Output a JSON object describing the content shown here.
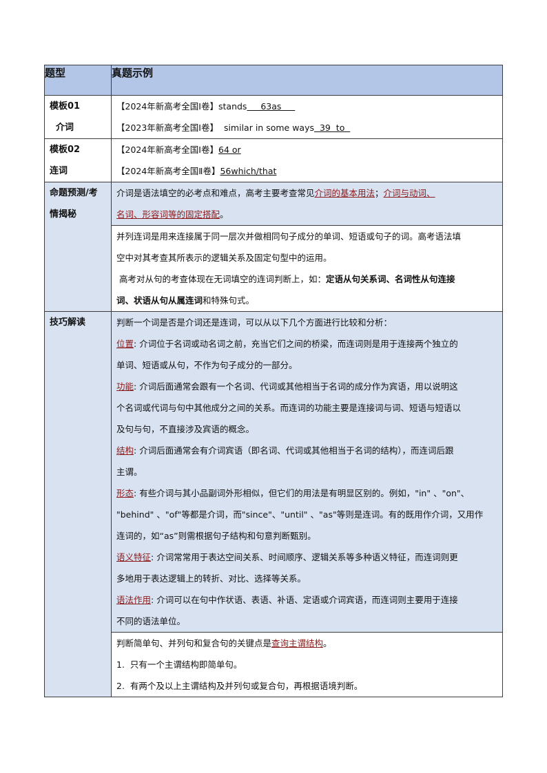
{
  "header": {
    "col1": "题型",
    "col2": "真题示例"
  },
  "row1": {
    "label_a": "模板01",
    "label_b": "介词",
    "ex1_pre": "【2024年新高考全国Ⅰ卷】stands",
    "ex1_ans": "     63as     ",
    "ex2_pre": "【2023年新高考全国Ⅰ卷】  similar in some ways",
    "ex2_ans": "  39  to  "
  },
  "row2": {
    "label_a": "模板02",
    "label_b": "连词",
    "ex1_pre": "【2024年新高考全国Ⅰ卷】",
    "ex1_ans": "64 or",
    "ex2_pre": "【2024年新高考全国Ⅱ卷】",
    "ex2_ans": "56which/that"
  },
  "row3": {
    "label_a": "命题预测/考",
    "label_b": "情揭秘",
    "p1_a": "介词是语法填空的必考点和难点，高考主要考查常见",
    "p1_u1": "介词的基本用法",
    "p1_b": "；",
    "p1_u2a": "介词与动词、",
    "p1_u2b": "名词、形容词等的固定搭配",
    "p1_c": "。"
  },
  "row4": {
    "l1": "并列连词是用来连接属于同一层次并做相同句子成分的单词、短语或句子的词。高考语法填",
    "l2": "空中对其考查其所表示的逻辑关系及固定句型中的运用。",
    "l3_a": " 高考对从句的考查体现在无词填空的连词判断上，如：",
    "l3_b": "定语从句关系词、名词性从句连接",
    "l4_a": "词、状语从句从属连词",
    "l4_b": "和特殊句式。"
  },
  "row5": {
    "label": "技巧解读",
    "l1": "判断一个词是否是介词还是连词，可以从以下几个方面进行比较和分析：",
    "pos_k": "位置",
    "pos_1": ": 介词位于名词或动名词之前，充当它们之间的桥梁，而连词则是用于连接两个独立的",
    "pos_2": "单词、短语或从句，不作为句子成分的一部分。",
    "fun_k": "功能",
    "fun_1": ": 介词后面通常会跟有一个名词、代词或其他相当于名词的成分作为宾语，用以说明这",
    "fun_2": "个名词或代词与句中其他成分之间的关系。而连词的功能主要是连接词与词、短语与短语以",
    "fun_3": "及句与句，不直接涉及宾语的概念。",
    "str_k": "结构",
    "str_1": ": 介词后面通常会有介词宾语（即名词、代词或其他相当于名词的结构），而连词后跟",
    "str_2": "主谓。",
    "mor_k": "形态",
    "mor_1": ": 有些介词与其小品副词外形相似，但它们的用法是有明显区别的。例如，\"in\" 、\"on\"、",
    "mor_2": "\"behind\" 、\"of\"等都是介词，而\"since\"、\"until\" 、\"as\"等则是连词。有的既用作介词，又用作",
    "mor_3": "连词的，如“as”则需根据句子结构和句意判断甄别。",
    "sem_k": "语义特征",
    "sem_1": ": 介词常常用于表达空间关系、时间顺序、逻辑关系等多种语义特征，而连词则更",
    "sem_2": "多地用于表达逻辑上的转折、对比、选择等关系。",
    "gra_k": "语法作用",
    "gra_1": ": 介词可以在句中作状语、表语、补语、定语或介词宾语，而连词则主要用于连接",
    "gra_2": "不同的语法单位。"
  },
  "row6": {
    "l1_a": "判断简单句、并列句和复合句的关键点是",
    "l1_u": "查询主谓结构",
    "l1_b": "。",
    "l2": "1.  只有一个主谓结构即简单句。",
    "l3": "2.  有两个及以上主谓结构及并列句或复合句，再根据语境判断。"
  }
}
